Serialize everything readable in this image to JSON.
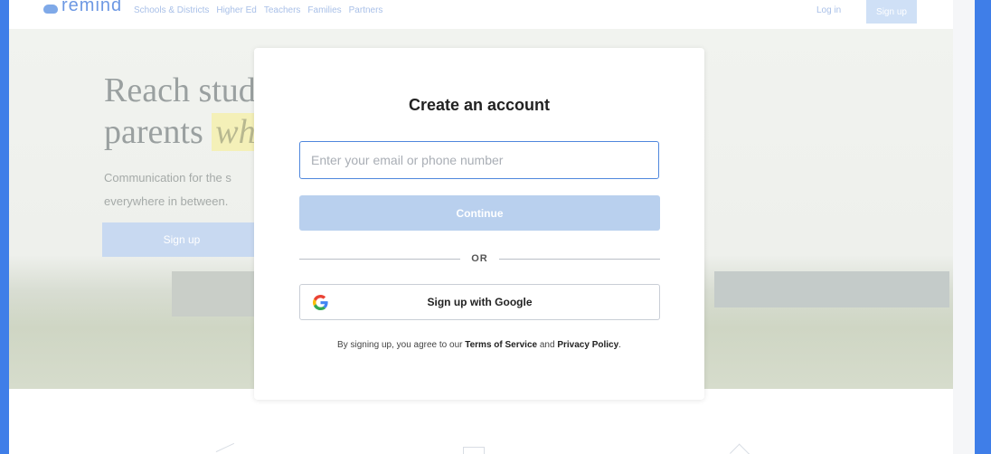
{
  "header": {
    "brand": "remind",
    "nav": [
      "Schools & Districts",
      "Higher Ed",
      "Teachers",
      "Families",
      "Partners"
    ],
    "login": "Log in",
    "signup": "Sign up"
  },
  "hero": {
    "title_line1": "Reach stud",
    "title_line2_plain": "parents ",
    "title_line2_highlight": "wh",
    "subtitle_line1": "Communication for the s",
    "subtitle_line2": "everywhere in between.",
    "cta": "Sign up"
  },
  "modal": {
    "title": "Create an account",
    "email_placeholder": "Enter your email or phone number",
    "email_value": "",
    "continue": "Continue",
    "or": "OR",
    "google": "Sign up with Google",
    "legal_prefix": "By signing up, you agree to our ",
    "terms": "Terms of Service",
    "legal_and": " and ",
    "privacy": "Privacy Policy",
    "legal_suffix": "."
  },
  "colors": {
    "frame": "#3f7ee8",
    "brand": "#6d98e3",
    "input_focus": "#4f87dd",
    "continue_disabled": "#b9d0ee"
  },
  "icons": {
    "brand": "remind-logo-icon",
    "google": "google-g-icon"
  }
}
